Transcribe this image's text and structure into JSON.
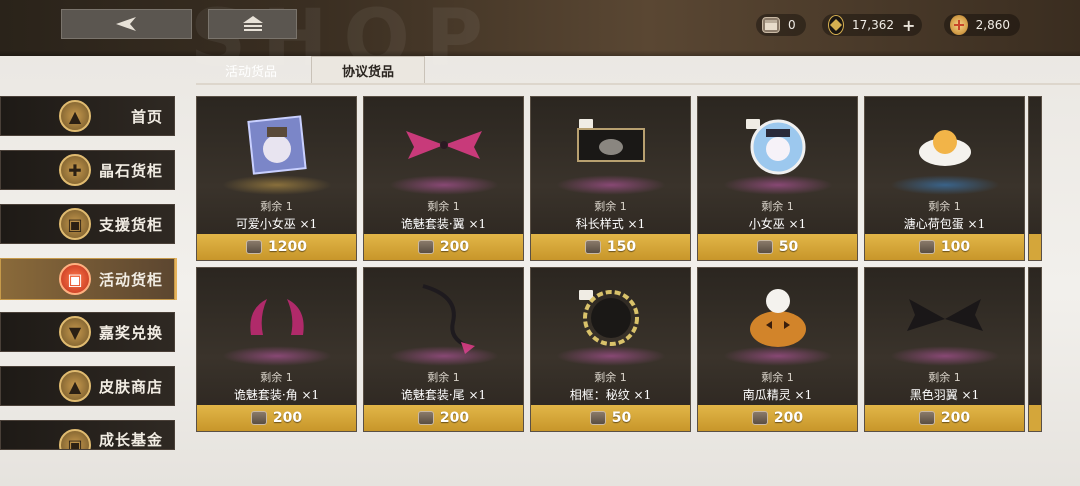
{
  "header": {
    "bg_text": "SHOP",
    "currencies": [
      {
        "name": "ticket",
        "value": "0",
        "icon": "ticket-chest-icon",
        "color": "#8b7b6a"
      },
      {
        "name": "gold",
        "value": "17,362",
        "icon": "gold-coin-icon",
        "color": "#2a2420"
      },
      {
        "name": "gem",
        "value": "2,860",
        "icon": "gem-orb-icon",
        "color": "#d6a04a"
      }
    ],
    "plus_label": "+"
  },
  "tabs": [
    {
      "label": "活动货品",
      "active": false
    },
    {
      "label": "协议货品",
      "active": true
    }
  ],
  "sidebar": {
    "items": [
      {
        "label": "首页",
        "icon": "thumbs-up-icon",
        "active": false
      },
      {
        "label": "晶石货柜",
        "icon": "crystal-icon",
        "active": false
      },
      {
        "label": "支援货柜",
        "icon": "supply-box-icon",
        "active": false
      },
      {
        "label": "活动货柜",
        "icon": "event-box-icon",
        "active": true
      },
      {
        "label": "嘉奖兑换",
        "icon": "reward-badge-icon",
        "active": false
      },
      {
        "label": "皮肤商店",
        "icon": "outfit-icon",
        "active": false
      },
      {
        "label": "成长基金",
        "icon": "fund-box-icon",
        "active": false
      }
    ]
  },
  "items": [
    {
      "name": "可爱小女巫 ×1",
      "remain": "剩余 1",
      "price": "1200",
      "icon": "witch-portrait-icon",
      "glow": "#c9a14a"
    },
    {
      "name": "诡魅套装·翼 ×1",
      "remain": "剩余 1",
      "price": "200",
      "icon": "pink-bat-wings-icon",
      "glow": "#c85ab0"
    },
    {
      "name": "科长样式 ×1",
      "remain": "剩余 1",
      "price": "150",
      "icon": "profile-card-icon",
      "glow": "#c85ab0"
    },
    {
      "name": "小女巫 ×1",
      "remain": "剩余 1",
      "price": "50",
      "icon": "witch-avatar-icon",
      "glow": "#c85ab0"
    },
    {
      "name": "溏心荷包蛋 ×1",
      "remain": "剩余 1",
      "price": "100",
      "icon": "fried-egg-icon",
      "glow": "#3b8ad6"
    },
    {
      "name": "诡魅套装·角 ×1",
      "remain": "剩余 1",
      "price": "200",
      "icon": "demon-horns-icon",
      "glow": "#c85ab0"
    },
    {
      "name": "诡魅套装·尾 ×1",
      "remain": "剩余 1",
      "price": "200",
      "icon": "demon-tail-icon",
      "glow": "#c85ab0"
    },
    {
      "name": "相框：秘纹 ×1",
      "remain": "剩余 1",
      "price": "50",
      "icon": "rune-frame-icon",
      "glow": "#c85ab0"
    },
    {
      "name": "南瓜精灵 ×1",
      "remain": "剩余 1",
      "price": "200",
      "icon": "pumpkin-ghost-icon",
      "glow": "#c85ab0"
    },
    {
      "name": "黑色羽翼 ×1",
      "remain": "剩余 1",
      "price": "200",
      "icon": "black-wings-icon",
      "glow": "#c85ab0"
    }
  ]
}
